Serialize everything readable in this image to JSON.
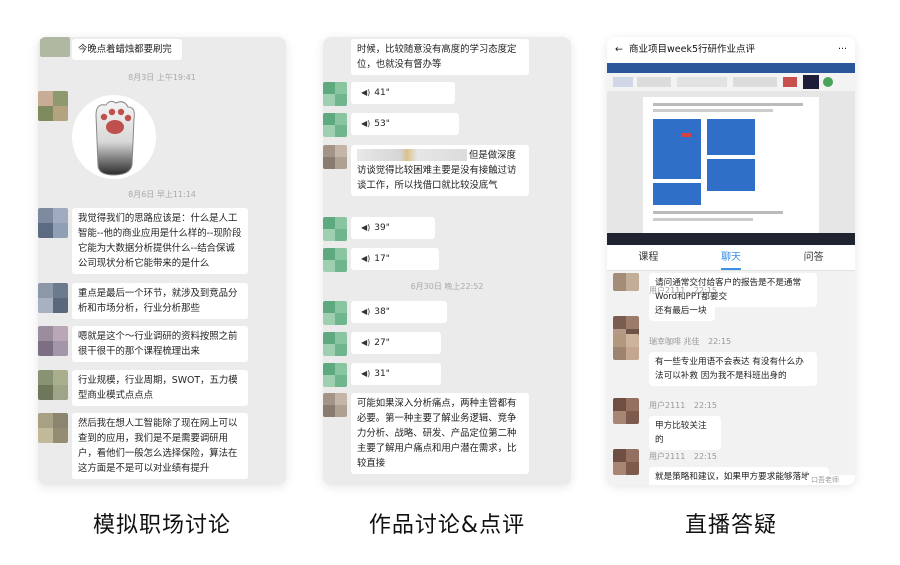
{
  "panels": {
    "discussion": {
      "caption": "模拟职场讨论",
      "first_message": "今晚点着蜡烛都要刷完",
      "ts1": "8月3日 上午19:41",
      "ts2": "8月6日 早上11:14",
      "messages": [
        "我觉得我们的思路应该是：什么是人工智能--他的商业应用是什么样的--现阶段它能为大数据分析提供什么--结合保诚公司现状分析它能带来的是什么",
        "重点是最后一个环节，就涉及到竞品分析和市场分析，行业分析那些",
        "嗯就是这个～行业调研的资料按照之前很干很干的那个课程梳理出来",
        "行业规模，行业周期，SWOT，五力模型商业模式点点点",
        "然后我在想人工智能除了现在网上可以查到的应用，我们是不是需要调研用户，看他们一般怎么选择保险，算法在这方面是不是可以对业绩有提升"
      ]
    },
    "review": {
      "caption": "作品讨论&点评",
      "top_text": "时候，比较随意没有高度的学习态度定位，也就没有督办等",
      "voices_a": [
        "41\"",
        "53\""
      ],
      "mid_text": "但是做深度访谈觉得比较困难主要是没有接触过访谈工作，所以找借口就比较没底气",
      "voices_b": [
        "39\"",
        "17\""
      ],
      "ts": "6月30日 晚上22:52",
      "voices_c": [
        "38\"",
        "27\"",
        "31\""
      ],
      "bottom_text": "可能如果深入分析痛点，两种主管都有必要。第一种主要了解业务逻辑、竞争力分析、战略、研发、产品定位第二种主要了解用户痛点和用户潜在需求，比较直接"
    },
    "qa": {
      "caption": "直播答疑",
      "header_title": "商业项目week5行研作业点评",
      "more_icon_text": "···",
      "tabs": [
        "课程",
        "聊天",
        "问答"
      ],
      "active_tab": "聊天",
      "messages": [
        {
          "user": "",
          "time": "",
          "text": "请问通常交付给客户的报告是不是通常Word和PPT都要交"
        },
        {
          "user": "用户2111",
          "time": "22:15",
          "text": "还有最后一块"
        },
        {
          "user": "瑞幸咖啡 兆佳",
          "time": "22:15",
          "text": "有一些专业用语不会表达 有没有什么办法可以补救 因为我不是科班出身的"
        },
        {
          "user": "用户2111",
          "time": "22:15",
          "text": "甲方比较关注的"
        },
        {
          "user": "用户2111",
          "time": "22:15",
          "text": "就是策略和建议，如果甲方要求能够落地"
        }
      ],
      "input_hint": "口吾老师"
    }
  },
  "colors": {
    "accent": "#3b8fe6",
    "panel_bg": "#ebebeb",
    "bubble_bg": "#ffffff"
  }
}
